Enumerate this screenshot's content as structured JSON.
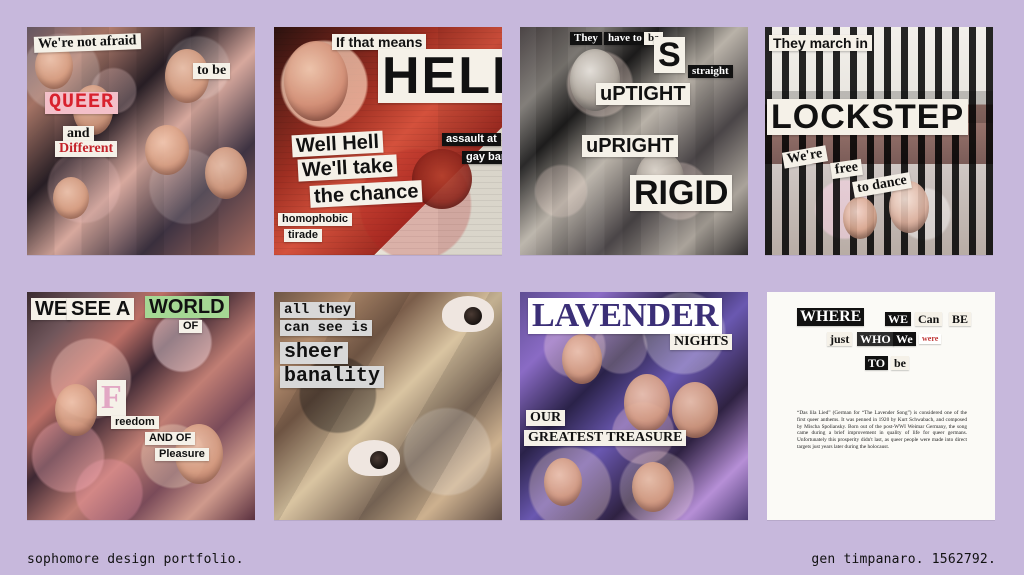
{
  "footer": {
    "left_text": "sophomore design portfolio.",
    "right_text": "gen timpanaro. 1562792."
  },
  "cards": [
    {
      "labels": [
        "We're not afraid",
        "to be",
        "QUEER",
        "and",
        "Different"
      ]
    },
    {
      "labels": [
        "If that means",
        "HELL",
        "Well Hell",
        "We'll take",
        "the chance",
        "assault at",
        "gay bar",
        "homophobic",
        "tirade"
      ]
    },
    {
      "labels": [
        "They",
        "have to",
        "be",
        "S",
        "straight",
        "uPTIGHT",
        "uPRIGHT",
        "RIGID"
      ]
    },
    {
      "labels": [
        "They march in",
        "LOCKSTEP",
        "We're ",
        "free",
        "to dance"
      ]
    },
    {
      "labels": [
        "WE",
        "SEE A",
        "WORLD",
        "OF",
        "F",
        "reedom",
        "AND OF",
        "Pleasure"
      ]
    },
    {
      "labels": [
        "all they",
        "can see is",
        "sheer",
        "banality"
      ]
    },
    {
      "labels": [
        "LAVENDER",
        "NIGHTS",
        "OUR",
        "GREATEST TREASURE"
      ]
    },
    {
      "labels": [
        "WHERE",
        "WE",
        "Can",
        "BE",
        "just",
        "WHO",
        "We",
        "were",
        "TO",
        "be"
      ],
      "paragraph": "“Das lila Lied” (German for “The Lavender Song”) is considered one of the first queer anthems. It was penned in 1920 by Kurt Schwabach, and composed by Mischa Spoliansky. Born out of the post-WWI Weimar Germany, the song came during a brief improvement in quality of life for queer germans. Unfortunately this prosperity didn't last, as queer people were made into direct targets just years later during the holocaust."
    }
  ]
}
